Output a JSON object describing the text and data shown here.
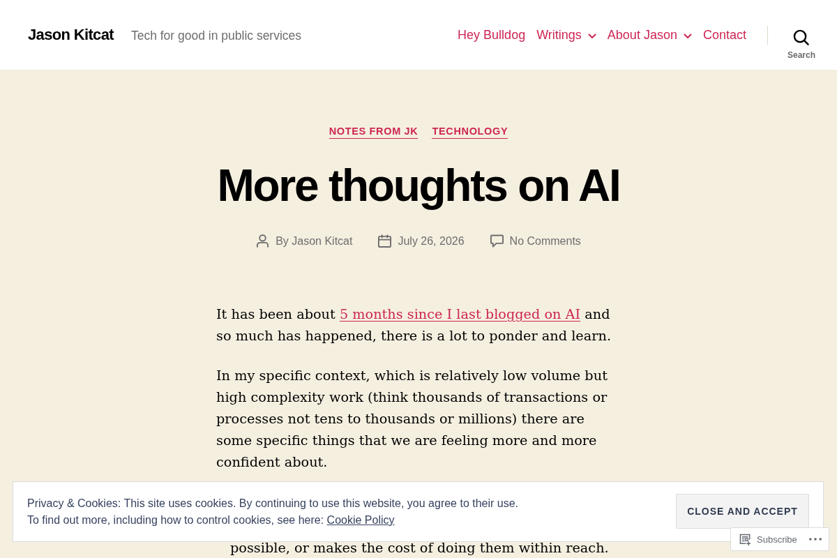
{
  "site": {
    "title": "Jason Kitcat",
    "tagline": "Tech for good in public services"
  },
  "nav": [
    {
      "label": "Hey Bulldog",
      "has_submenu": false
    },
    {
      "label": "Writings",
      "has_submenu": true
    },
    {
      "label": "About Jason",
      "has_submenu": true
    },
    {
      "label": "Contact",
      "has_submenu": false
    }
  ],
  "search": {
    "label": "Search"
  },
  "post": {
    "categories": [
      "NOTES FROM JK",
      "TECHNOLOGY"
    ],
    "title": "More thoughts on AI",
    "meta": [
      {
        "kind": "author",
        "text": "By Jason Kitcat"
      },
      {
        "kind": "date",
        "text": "July 26, 2026"
      },
      {
        "kind": "comments",
        "text": "No Comments"
      }
    ],
    "paragraphs": [
      {
        "parts": [
          {
            "kind": "text",
            "text": "It has been about "
          },
          {
            "kind": "link",
            "text": "5 months since I last blogged on AI"
          },
          {
            "kind": "text",
            "text": " and so much has happened, there is a lot to ponder and learn."
          }
        ]
      },
      {
        "parts": [
          {
            "kind": "text",
            "text": "In my specific context, which is relatively low volume but high complexity work (think thousands of transactions or processes not tens to thousands or millions) there are some specific things that we are feeling more and more confident about."
          }
        ]
      }
    ],
    "partial_line": "possible, or makes the cost of doing them within reach."
  },
  "cookie_banner": {
    "lines": [
      {
        "text": "Privacy & Cookies: This site uses cookies. By continuing to use this website, you agree to their use."
      },
      {
        "text": "To find out more, including how to control cookies, see here: ",
        "link": "Cookie Policy"
      }
    ],
    "button": "CLOSE AND ACCEPT"
  },
  "subscribe_widget": {
    "label": "Subscribe"
  }
}
